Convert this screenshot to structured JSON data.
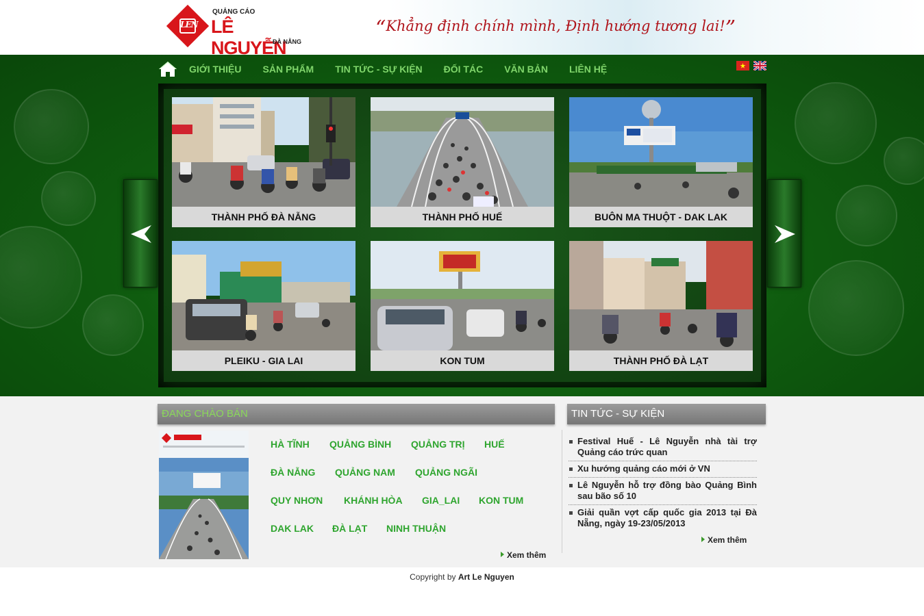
{
  "header": {
    "logo_small": "QUẢNG CÁO",
    "logo_big": "LÊ NGUYỄN",
    "logo_city": "ĐÀ NẴNG",
    "logo_mark": "LEN",
    "slogan": "Khẳng định chính mình, Định hướng tương lai!"
  },
  "nav": {
    "home_icon": "home-icon",
    "items": [
      "GIỚI THIỆU",
      "SẢN PHẨM",
      "TIN TỨC - SỰ KIỆN",
      "ĐỐI TÁC",
      "VĂN BẢN",
      "LIÊN HỆ"
    ],
    "languages": [
      "vietnamese-flag-icon",
      "english-flag-icon"
    ]
  },
  "gallery": {
    "prev_icon": "arrow-left-icon",
    "next_icon": "arrow-right-icon",
    "cards": [
      {
        "caption": "THÀNH PHỐ ĐÀ NẴNG"
      },
      {
        "caption": "THÀNH PHỐ HUẾ"
      },
      {
        "caption": "BUÔN MA THUỘT - DAK LAK"
      },
      {
        "caption": "PLEIKU - GIA LAI"
      },
      {
        "caption": "KON TUM"
      },
      {
        "caption": "THÀNH PHỐ ĐÀ LẠT"
      }
    ]
  },
  "offers": {
    "title": "ĐANG CHÀO BÁN",
    "cities": [
      "HÀ TĨNH",
      "QUẢNG BÌNH",
      "QUẢNG TRỊ",
      "HUẾ",
      "ĐÀ NẴNG",
      "QUẢNG NAM",
      "QUẢNG NGÃI",
      "QUY NHƠN",
      "KHÁNH HÒA",
      "GIA_LAI",
      "KON TUM",
      "DAK LAK",
      "ĐÀ LẠT",
      "NINH THUẬN"
    ],
    "more": "Xem thêm"
  },
  "news": {
    "title": "TIN TỨC - SỰ KIỆN",
    "items": [
      "Festival Huế - Lê Nguyễn nhà tài trợ Quảng cáo trức quan",
      "Xu hướng quảng cáo mới ở VN",
      "Lê Nguyễn hỗ trợ đồng bào Quảng Bình sau bão số 10",
      "Giải quần vợt cấp quốc gia 2013 tại Đà Nẵng, ngày 19-23/05/2013"
    ],
    "more": "Xem thêm"
  },
  "footer": {
    "copyright_prefix": "Copyright by",
    "copyright_owner": "Art Le Nguyen"
  }
}
